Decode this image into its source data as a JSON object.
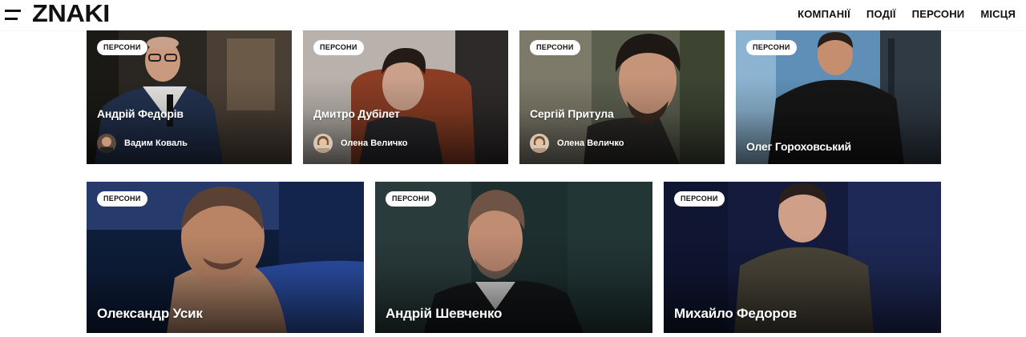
{
  "header": {
    "logo": "ZNAKI",
    "nav": [
      "КОМПАНІЇ",
      "ПОДІЇ",
      "ПЕРСОНИ",
      "МІСЦЯ"
    ]
  },
  "cards_row1": [
    {
      "badge": "ПЕРСОНИ",
      "name": "Андрій Федорів",
      "author": "Вадим Коваль"
    },
    {
      "badge": "ПЕРСОНИ",
      "name": "Дмитро Дубілет",
      "author": "Олена Величко"
    },
    {
      "badge": "ПЕРСОНИ",
      "name": "Сергій Притула",
      "author": "Олена Величко"
    },
    {
      "badge": "ПЕРСОНИ",
      "name": "Олег Гороховський"
    }
  ],
  "cards_row2": [
    {
      "badge": "ПЕРСОНИ",
      "name": "Олександр Усик"
    },
    {
      "badge": "ПЕРСОНИ",
      "name": "Андрій Шевченко"
    },
    {
      "badge": "ПЕРСОНИ",
      "name": "Михайло Федоров"
    }
  ],
  "colors": {
    "text": "#111111",
    "badge_bg": "#ffffff",
    "card_text": "#ffffff"
  }
}
